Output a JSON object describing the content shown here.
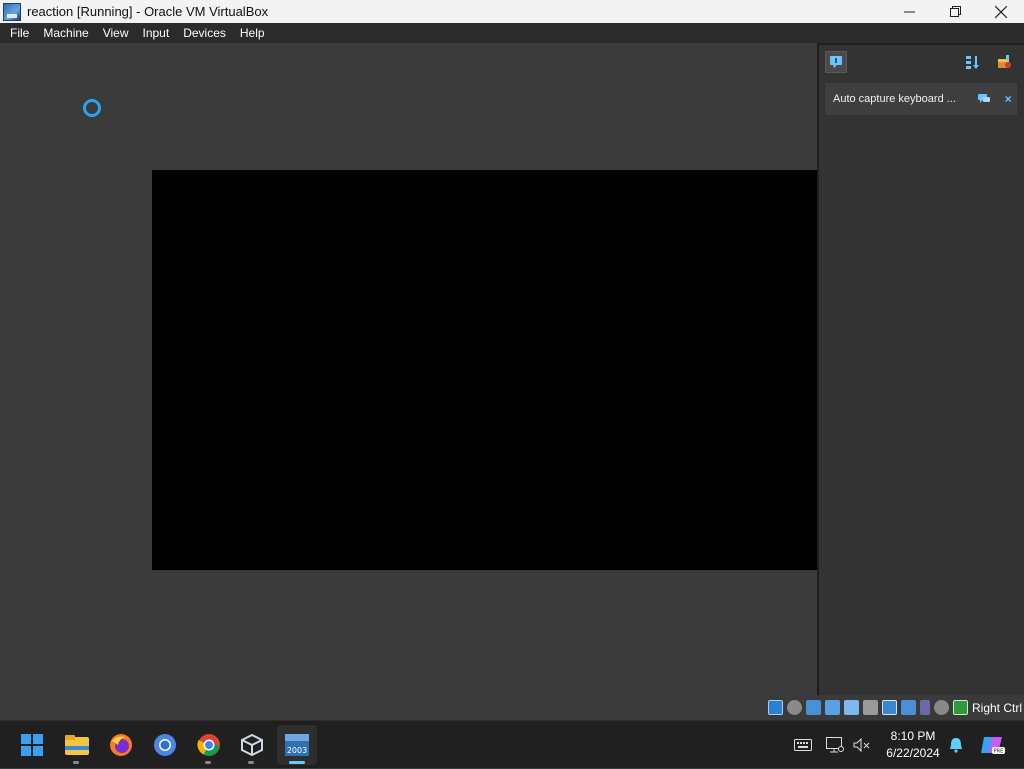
{
  "window": {
    "title": "reaction [Running] - Oracle VM VirtualBox",
    "controls": {
      "minimize": "—",
      "maximize": "☐",
      "close": "✕"
    }
  },
  "menu": {
    "items": [
      "File",
      "Machine",
      "View",
      "Input",
      "Devices",
      "Help"
    ]
  },
  "notification_panel": {
    "message": "Auto capture keyboard ...",
    "close_symbol": "×"
  },
  "statusbar": {
    "host_key": "Right Ctrl",
    "icons": [
      "hard-disk-icon",
      "optical-drive-icon",
      "audio-icon",
      "network-icon",
      "usb-icon",
      "shared-folders-icon",
      "display-icon",
      "recording-icon",
      "cpu-icon",
      "mouse-integration-icon",
      "keyboard-capture-icon"
    ]
  },
  "taskbar": {
    "apps": [
      "start-icon",
      "file-explorer-icon",
      "firefox-icon",
      "chromium-icon",
      "chrome-icon",
      "virtualbox-icon",
      "vm-window-icon"
    ],
    "vm_thumbnail_text": "2003",
    "clock_time": "8:10 PM",
    "clock_date": "6/22/2024"
  },
  "colors": {
    "accent": "#29a3f0",
    "vm_bg": "#3a3a3a",
    "taskbar_bg": "#202020"
  }
}
